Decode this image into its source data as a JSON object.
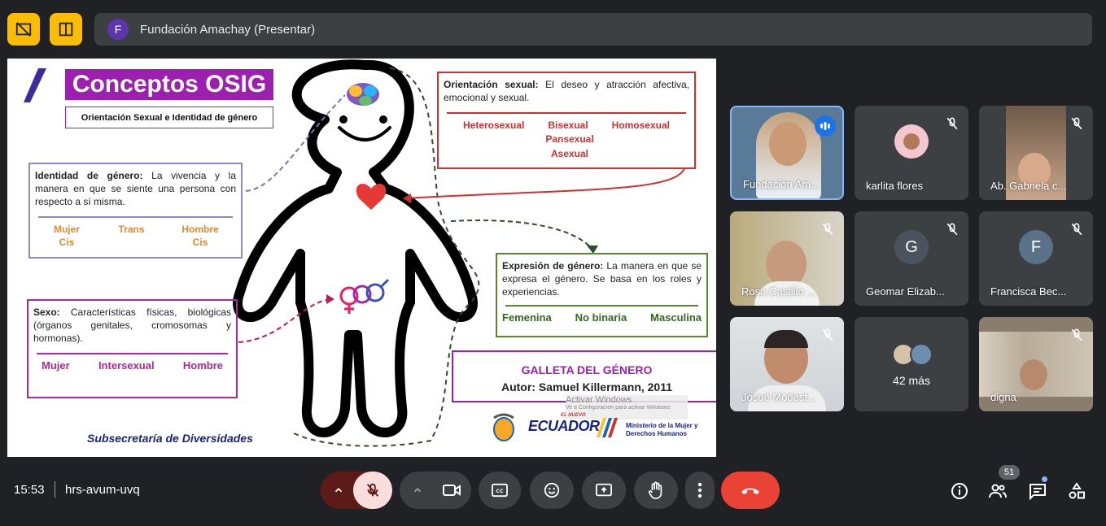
{
  "presenter": {
    "initial": "F",
    "name": "Fundación Amachay (Presentar)"
  },
  "slide": {
    "title": "Conceptos OSIG",
    "subtitle": "Orientación Sexual e Identidad de género",
    "orientation": {
      "term": "Orientación sexual:",
      "text": " El deseo y atracción afectiva, emocional y sexual.",
      "items": [
        "Heterosexual",
        "Bisexual",
        "Homosexual"
      ],
      "extra": [
        "Pansexual",
        "Asexual"
      ]
    },
    "identity": {
      "term": "Identidad de género:",
      "text": " La vivencia y la manera en que se siente una persona con respecto a sí misma.",
      "items": [
        "Mujer Cis",
        "Trans",
        "Hombre Cis"
      ]
    },
    "expression": {
      "term": "Expresión de género:",
      "text": " La manera en que se expresa el género. Se basa en los roles y experiencias.",
      "items": [
        "Femenina",
        "No binaria",
        "Masculina"
      ]
    },
    "sex": {
      "term": "Sexo:",
      "text": " Características físicas, biológicas (órganos genitales, cromosomas y hormonas).",
      "items": [
        "Mujer",
        "Intersexual",
        "Hombre"
      ]
    },
    "credit": {
      "title": "GALLETA DEL GÉNERO",
      "author": "Autor: Samuel Killermann, 2011"
    },
    "footer": "Subsecretaría de Diversidades",
    "logo": {
      "country": "ECUADOR",
      "small": "EL NUEVO",
      "ministry_line1": "Ministerio de la Mujer y",
      "ministry_line2": "Derechos Humanos"
    },
    "watermark": {
      "line1": "Activar Windows",
      "line2": "Ve a Configuración para activar Windows."
    }
  },
  "participants": [
    {
      "name": "Fundación Am...",
      "speaking": true
    },
    {
      "name": "karlita flores",
      "muted": true
    },
    {
      "name": "Ab. Gabriela c...",
      "muted": true
    },
    {
      "name": "Rosa Castillo ...",
      "muted": true
    },
    {
      "name": "Geomar Elizab...",
      "initial": "G",
      "muted": true
    },
    {
      "name": "Francisca Bec...",
      "initial": "F",
      "muted": true
    },
    {
      "name": "Josué Modest...",
      "muted": true
    },
    {
      "name": "42 más"
    },
    {
      "name": "digna",
      "muted": true
    }
  ],
  "bottombar": {
    "time": "15:53",
    "meeting_code": "hrs-avum-uvq",
    "people_count": "51"
  },
  "colors": {
    "accent_yellow": "#fbbc04",
    "end_call": "#ea4335",
    "mic_off": "#f9dedc",
    "purple": "#9c1fb0"
  }
}
